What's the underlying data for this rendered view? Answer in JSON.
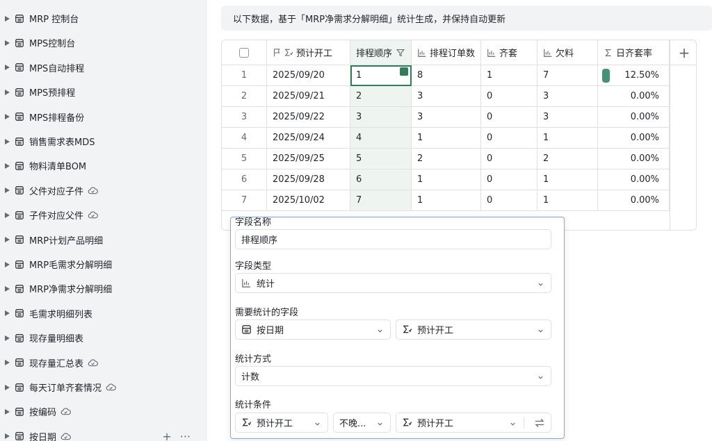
{
  "sidebar": {
    "items": [
      {
        "label": "MRP 控制台",
        "synced": false
      },
      {
        "label": "MPS控制台",
        "synced": false
      },
      {
        "label": "MPS自动排程",
        "synced": false
      },
      {
        "label": "MPS预排程",
        "synced": false
      },
      {
        "label": "MPS排程备份",
        "synced": false
      },
      {
        "label": "销售需求表MDS",
        "synced": false
      },
      {
        "label": "物料清单BOM",
        "synced": false
      },
      {
        "label": "父件对应子件",
        "synced": true
      },
      {
        "label": "子件对应父件",
        "synced": true
      },
      {
        "label": "MRP计划产品明细",
        "synced": false
      },
      {
        "label": "MRP毛需求分解明细",
        "synced": false
      },
      {
        "label": "MRP净需求分解明细",
        "synced": false
      },
      {
        "label": "毛需求明细列表",
        "synced": false
      },
      {
        "label": "现存量明细表",
        "synced": false
      },
      {
        "label": "现存量汇总表",
        "synced": true
      },
      {
        "label": "每天订单齐套情况",
        "synced": true
      },
      {
        "label": "按编码",
        "synced": true
      },
      {
        "label": "按日期",
        "synced": true
      }
    ],
    "add_label": "+",
    "more_label": "···"
  },
  "banner": {
    "text": "以下数据，基于「MRP净需求分解明细」统计生成，并保持自动更新"
  },
  "table": {
    "columns": [
      {
        "key": "date",
        "label": "预计开工"
      },
      {
        "key": "seq",
        "label": "排程顺序"
      },
      {
        "key": "orders",
        "label": "排程订单数"
      },
      {
        "key": "complete",
        "label": "齐套"
      },
      {
        "key": "short",
        "label": "欠料"
      },
      {
        "key": "rate",
        "label": "日齐套率"
      }
    ],
    "rows": [
      {
        "n": "1",
        "date": "2025/09/20",
        "seq": "1",
        "orders": "8",
        "complete": "1",
        "short": "7",
        "rate": "12.50%"
      },
      {
        "n": "2",
        "date": "2025/09/21",
        "seq": "2",
        "orders": "3",
        "complete": "0",
        "short": "3",
        "rate": "0.00%"
      },
      {
        "n": "3",
        "date": "2025/09/22",
        "seq": "3",
        "orders": "3",
        "complete": "0",
        "short": "3",
        "rate": "0.00%"
      },
      {
        "n": "4",
        "date": "2025/09/24",
        "seq": "4",
        "orders": "1",
        "complete": "0",
        "short": "1",
        "rate": "0.00%"
      },
      {
        "n": "5",
        "date": "2025/09/25",
        "seq": "5",
        "orders": "2",
        "complete": "0",
        "short": "2",
        "rate": "0.00%"
      },
      {
        "n": "6",
        "date": "2025/09/28",
        "seq": "6",
        "orders": "1",
        "complete": "0",
        "short": "1",
        "rate": "0.00%"
      },
      {
        "n": "7",
        "date": "2025/10/02",
        "seq": "7",
        "orders": "1",
        "complete": "0",
        "short": "1",
        "rate": "0.00%"
      }
    ],
    "add_column_label": "+"
  },
  "panel": {
    "field_name_label": "字段名称",
    "field_name_value": "排程顺序",
    "field_type_label": "字段类型",
    "field_type_value": "统计",
    "stat_field_label": "需要统计的字段",
    "stat_table_value": "按日期",
    "stat_field_value": "预计开工",
    "stat_method_label": "统计方式",
    "stat_method_value": "计数",
    "condition_label": "统计条件",
    "cond_field_value": "预计开工",
    "cond_operator_value": "不晚...",
    "cond_target_value": "预计开工"
  },
  "colors": {
    "accent": "#2f7d5a",
    "selected_column": "#eef5f1",
    "panel_border": "#7aa9f0"
  }
}
